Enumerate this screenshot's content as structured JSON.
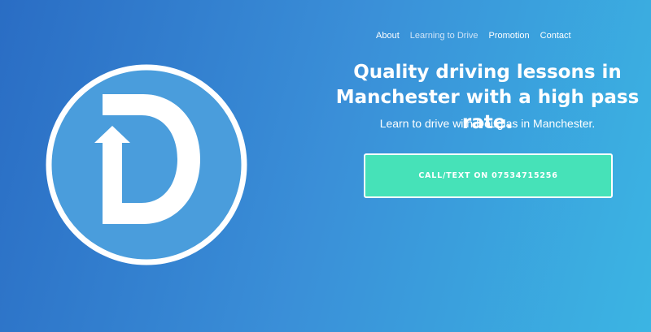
{
  "nav": {
    "items": [
      {
        "label": "About"
      },
      {
        "label": "Learning to Drive"
      },
      {
        "label": "Promotion"
      },
      {
        "label": "Contact"
      }
    ]
  },
  "hero": {
    "headline_line1": "Quality driving lessons in",
    "headline_line2": "Manchester with a high pass rate.",
    "subheadline": "Learn to drive with Douglas in Manchester.",
    "cta_label": "CALL/TEXT ON 07534715256"
  },
  "logo": {
    "icon": "d-arrow-logo-icon",
    "letter": "D"
  },
  "colors": {
    "background_start": "#2a6dc4",
    "background_end": "#3bb5e3",
    "logo_fill": "#4a9ddc",
    "cta": "#46e2b8",
    "text": "#ffffff"
  }
}
